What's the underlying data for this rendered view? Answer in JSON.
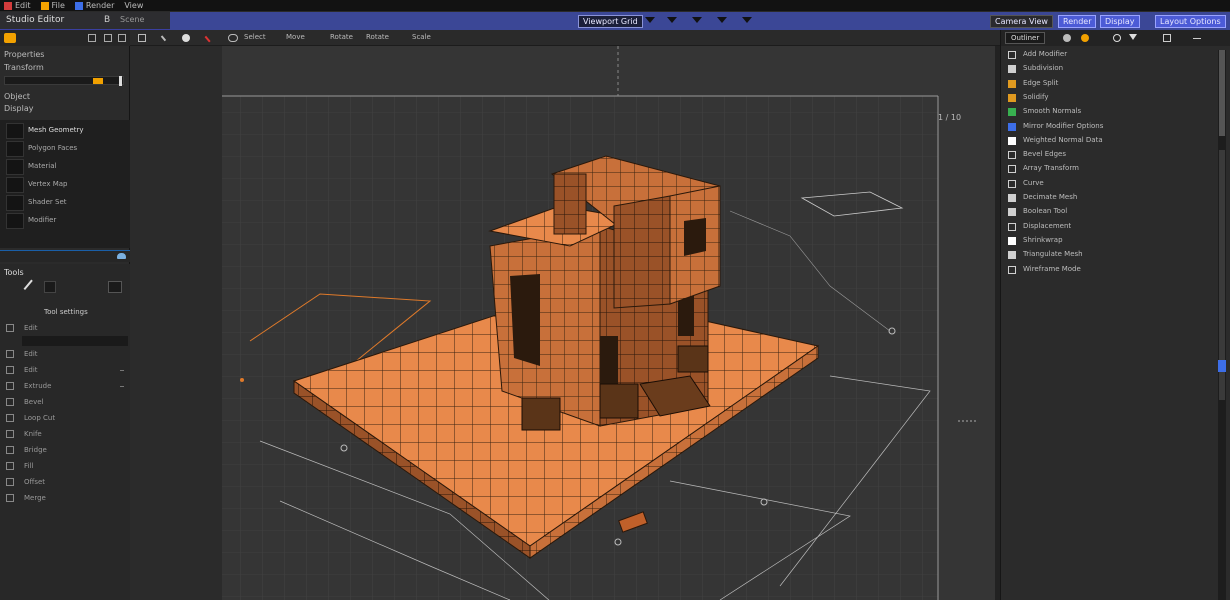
{
  "menubar": {
    "items": [
      "Edit",
      "File",
      "Render",
      "View"
    ]
  },
  "header": {
    "title": "Studio Editor",
    "b_label": "B",
    "subtitle": "Scene",
    "view_dropdown": "Viewport Grid",
    "buttons": [
      "Camera View",
      "Render",
      "Display",
      "Layout Options"
    ]
  },
  "left_panel": {
    "rows": [
      "Properties",
      "Transform",
      "Object",
      "Display"
    ],
    "outliner": [
      "Mesh Geometry",
      "Polygon Faces",
      "Material",
      "Vertex Map",
      "Shader Set",
      "Modifier"
    ],
    "section": "Tools",
    "tool_label": "Tool settings",
    "prop_rows": [
      "Edit",
      "",
      "Edit",
      "Edit",
      "Extrude",
      "Bevel",
      "Loop Cut",
      "Knife",
      "Bridge",
      "Fill",
      "Offset",
      "Merge"
    ],
    "colors": {
      "accent": "#f2a100"
    }
  },
  "viewport_toolbar": {
    "items": [
      "Select",
      "Move",
      "Rotate",
      "Scale"
    ]
  },
  "right_panel": {
    "tab": "Outliner",
    "items": [
      "Add Modifier",
      "Subdivision",
      "Edge Split",
      "Solidify",
      "Smooth Normals",
      "Mirror Modifier Options",
      "Weighted Normal Data",
      "Bevel Edges",
      "Array Transform",
      "Curve",
      "Decimate Mesh",
      "Boolean Tool",
      "Displacement",
      "Shrinkwrap",
      "Triangulate Mesh",
      "Wireframe Mode"
    ],
    "icon_colors": [
      "#d0d0d0",
      "#d0d0d0",
      "#e09a20",
      "#e09a20",
      "#38b050",
      "#3d6ee8",
      "#ffffff",
      "#d0d0d0",
      "#d0d0d0",
      "#d0d0d0",
      "#d0d0d0",
      "#d0d0d0",
      "#d0d0d0",
      "#ffffff",
      "#d0d0d0",
      "#d0d0d0"
    ]
  },
  "scene": {
    "model_color": "#e8894b",
    "grid_color": "#474747"
  }
}
